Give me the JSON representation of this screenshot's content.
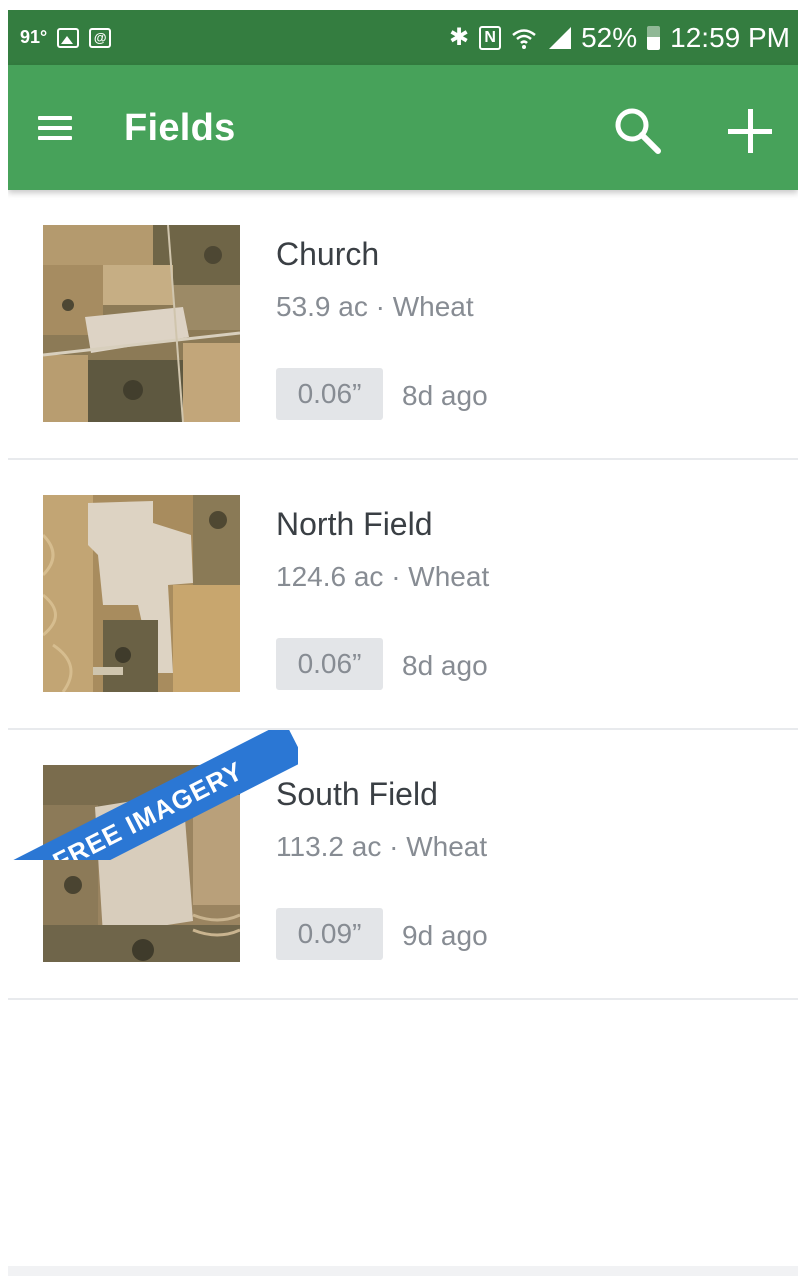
{
  "status_bar": {
    "temperature": "91°",
    "battery": "52%",
    "time": "12:59 PM",
    "left_icons": [
      "gallery-icon",
      "at-sign-icon"
    ],
    "right_icons": [
      "bluetooth-icon",
      "nfc-icon",
      "wifi-icon",
      "signal-icon",
      "battery-icon"
    ],
    "nfc_glyph": "N",
    "at_glyph": "@"
  },
  "app_bar": {
    "title": "Fields",
    "menu_icon": "hamburger-menu-icon",
    "search_icon": "search-icon",
    "add_icon": "plus-icon"
  },
  "colors": {
    "status_bar": "#347d40",
    "app_bar": "#47a25a",
    "ribbon": "#2b77d4",
    "text_primary": "#3a3f44",
    "text_secondary": "#878c93",
    "badge_bg": "#e3e5e8"
  },
  "fields": [
    {
      "name": "Church",
      "meta": "53.9 ac · Wheat",
      "rain": "0.06”",
      "updated": "8d ago"
    },
    {
      "name": "North Field",
      "meta": "124.6 ac · Wheat",
      "rain": "0.06”",
      "updated": "8d ago"
    },
    {
      "name": "South Field",
      "meta": "113.2 ac · Wheat",
      "rain": "0.09”",
      "updated": "9d ago",
      "ribbon": "FREE IMAGERY"
    }
  ]
}
